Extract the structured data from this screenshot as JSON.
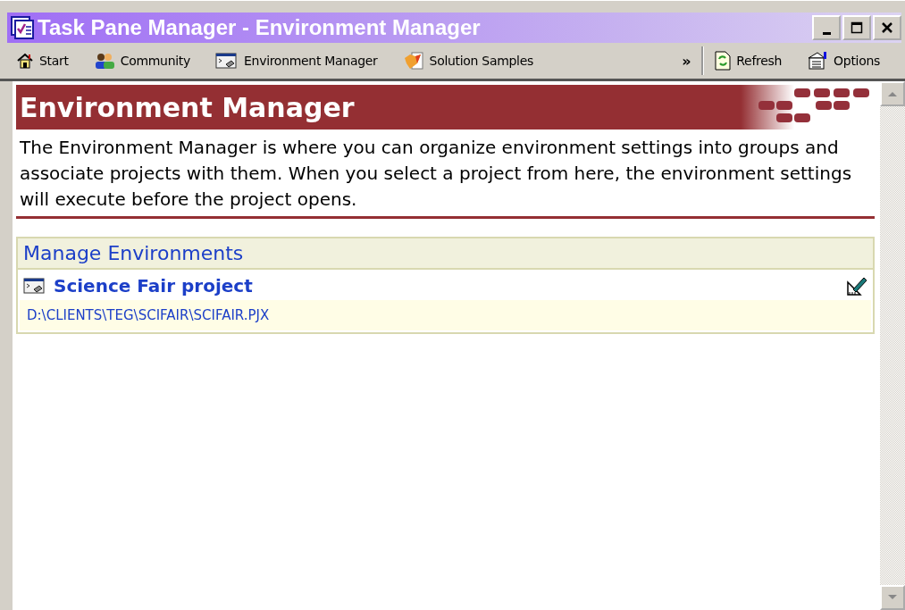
{
  "window": {
    "title": "Task Pane Manager - Environment Manager"
  },
  "toolbar": {
    "items": [
      {
        "label": "Start",
        "kind": "home"
      },
      {
        "label": "Community",
        "kind": "people"
      },
      {
        "label": "Environment Manager",
        "kind": "console"
      },
      {
        "label": "Solution Samples",
        "kind": "fox"
      }
    ],
    "overflow": "»",
    "right_items": [
      {
        "label": "Refresh",
        "kind": "refresh"
      },
      {
        "label": "Options",
        "kind": "options"
      }
    ]
  },
  "header": {
    "title": "Environment Manager"
  },
  "description": "The Environment Manager is where you can organize environment settings into groups and associate projects with them. When you select a project from here, the environment settings will execute before the project opens.",
  "section": {
    "title": "Manage Environments",
    "projects": [
      {
        "name": "Science Fair project",
        "path": "D:\\CLIENTS\\TEG\\SCIFAIR\\SCIFAIR.PJX"
      }
    ]
  }
}
